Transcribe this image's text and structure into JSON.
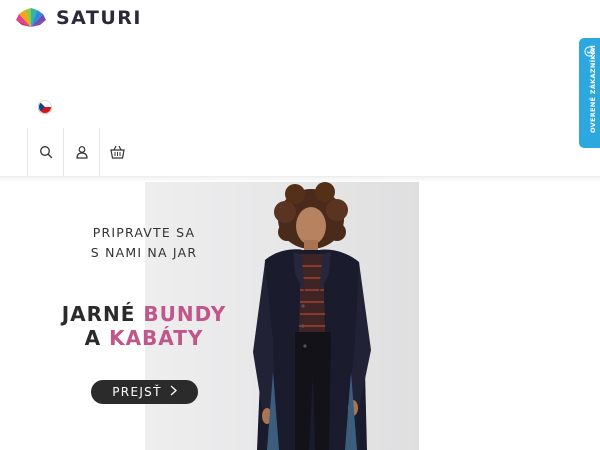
{
  "header": {
    "brand": "SATURI",
    "language_icon": "czech-flag-icon"
  },
  "toolbar": {
    "search_icon": "search-icon",
    "account_icon": "user-icon",
    "cart_icon": "basket-icon"
  },
  "verified_tab": {
    "label": "OVERENÉ ZÁKAZNÍKMI",
    "icon": "check-badge-icon",
    "color": "#2da8de"
  },
  "banner": {
    "promo_line_1": "PRIPRAVTE SA",
    "promo_line_2": "S NAMI NA JAR",
    "headline_1_part_1": "JARNÉ ",
    "headline_1_part_2": "BUNDY",
    "headline_2_part_1": "A ",
    "headline_2_part_2": "KABÁTY",
    "cta_label": "PREJSŤ",
    "accent_color": "#c0568a"
  }
}
